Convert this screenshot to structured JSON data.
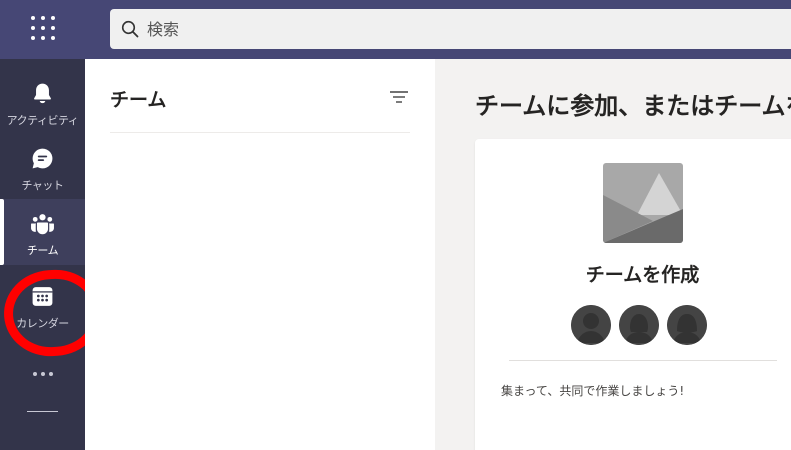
{
  "topbar": {
    "search": {
      "placeholder": "検索",
      "value": ""
    }
  },
  "rail": {
    "items": [
      {
        "label": "アクティビティ",
        "icon": "bell-icon"
      },
      {
        "label": "チャット",
        "icon": "chat-icon"
      },
      {
        "label": "チーム",
        "icon": "teams-icon",
        "active": true
      },
      {
        "label": "カレンダー",
        "icon": "calendar-icon"
      }
    ],
    "more_icon": "more-horizontal-icon"
  },
  "midpane": {
    "title": "チーム",
    "filter_icon": "filter-icon"
  },
  "main": {
    "title": "チームに参加、またはチームを作成",
    "card": {
      "title": "チームを作成",
      "description": "集まって、共同で作業しましょう!"
    }
  },
  "colors": {
    "topbar": "#464775",
    "rail": "#33344a",
    "annotation": "#ff0000"
  }
}
